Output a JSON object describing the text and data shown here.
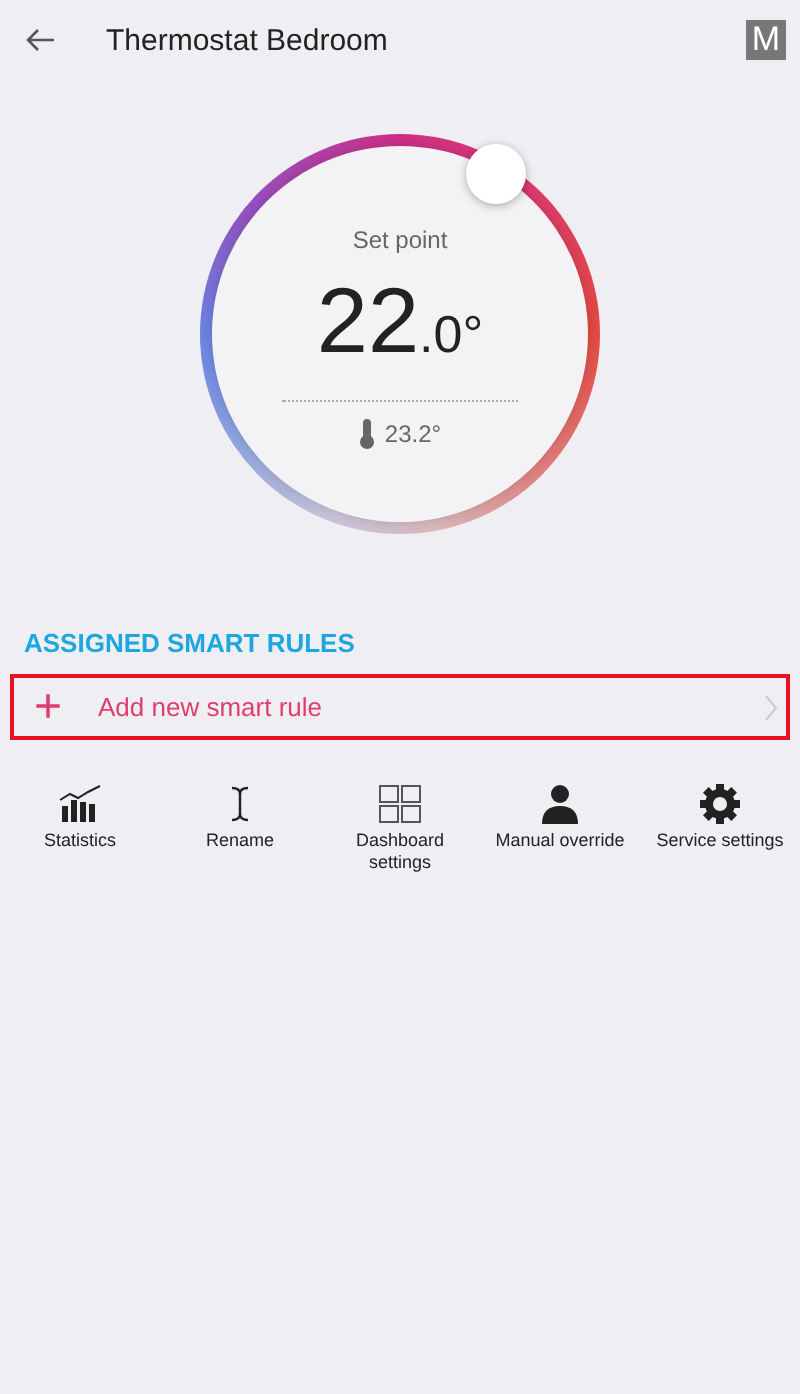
{
  "header": {
    "title": "Thermostat Bedroom",
    "badge": "M"
  },
  "dial": {
    "label": "Set point",
    "value_whole": "22",
    "value_fraction": ".0°",
    "current": "23.2°"
  },
  "section": {
    "title": "ASSIGNED SMART RULES"
  },
  "add_rule": {
    "icon": "+",
    "label": "Add new smart rule",
    "highlighted": true
  },
  "actions": [
    {
      "kind": "statistics",
      "label": "Statistics"
    },
    {
      "kind": "rename",
      "label": "Rename"
    },
    {
      "kind": "dashboard",
      "label": "Dashboard settings"
    },
    {
      "kind": "person",
      "label": "Manual override"
    },
    {
      "kind": "gear",
      "label": "Service settings"
    }
  ]
}
